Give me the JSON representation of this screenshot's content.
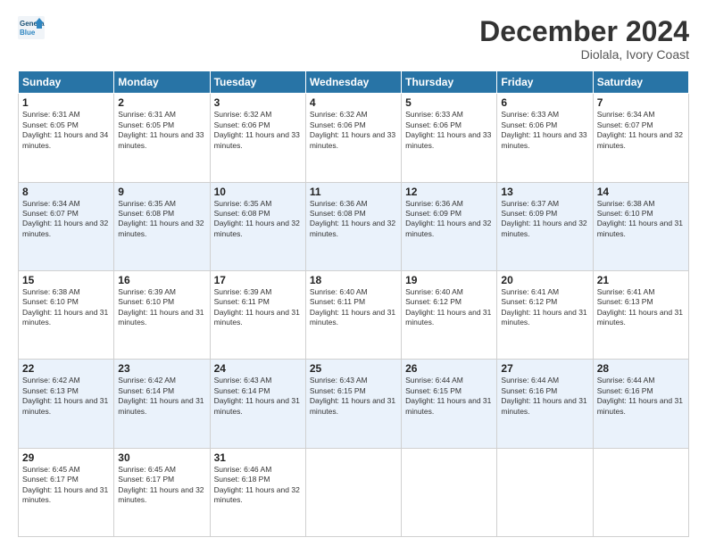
{
  "logo": {
    "line1": "General",
    "line2": "Blue"
  },
  "header": {
    "month": "December 2024",
    "location": "Diolala, Ivory Coast"
  },
  "weekdays": [
    "Sunday",
    "Monday",
    "Tuesday",
    "Wednesday",
    "Thursday",
    "Friday",
    "Saturday"
  ],
  "weeks": [
    [
      {
        "day": "1",
        "sunrise": "6:31 AM",
        "sunset": "6:05 PM",
        "daylight": "11 hours and 34 minutes."
      },
      {
        "day": "2",
        "sunrise": "6:31 AM",
        "sunset": "6:05 PM",
        "daylight": "11 hours and 33 minutes."
      },
      {
        "day": "3",
        "sunrise": "6:32 AM",
        "sunset": "6:06 PM",
        "daylight": "11 hours and 33 minutes."
      },
      {
        "day": "4",
        "sunrise": "6:32 AM",
        "sunset": "6:06 PM",
        "daylight": "11 hours and 33 minutes."
      },
      {
        "day": "5",
        "sunrise": "6:33 AM",
        "sunset": "6:06 PM",
        "daylight": "11 hours and 33 minutes."
      },
      {
        "day": "6",
        "sunrise": "6:33 AM",
        "sunset": "6:06 PM",
        "daylight": "11 hours and 33 minutes."
      },
      {
        "day": "7",
        "sunrise": "6:34 AM",
        "sunset": "6:07 PM",
        "daylight": "11 hours and 32 minutes."
      }
    ],
    [
      {
        "day": "8",
        "sunrise": "6:34 AM",
        "sunset": "6:07 PM",
        "daylight": "11 hours and 32 minutes."
      },
      {
        "day": "9",
        "sunrise": "6:35 AM",
        "sunset": "6:08 PM",
        "daylight": "11 hours and 32 minutes."
      },
      {
        "day": "10",
        "sunrise": "6:35 AM",
        "sunset": "6:08 PM",
        "daylight": "11 hours and 32 minutes."
      },
      {
        "day": "11",
        "sunrise": "6:36 AM",
        "sunset": "6:08 PM",
        "daylight": "11 hours and 32 minutes."
      },
      {
        "day": "12",
        "sunrise": "6:36 AM",
        "sunset": "6:09 PM",
        "daylight": "11 hours and 32 minutes."
      },
      {
        "day": "13",
        "sunrise": "6:37 AM",
        "sunset": "6:09 PM",
        "daylight": "11 hours and 32 minutes."
      },
      {
        "day": "14",
        "sunrise": "6:38 AM",
        "sunset": "6:10 PM",
        "daylight": "11 hours and 31 minutes."
      }
    ],
    [
      {
        "day": "15",
        "sunrise": "6:38 AM",
        "sunset": "6:10 PM",
        "daylight": "11 hours and 31 minutes."
      },
      {
        "day": "16",
        "sunrise": "6:39 AM",
        "sunset": "6:10 PM",
        "daylight": "11 hours and 31 minutes."
      },
      {
        "day": "17",
        "sunrise": "6:39 AM",
        "sunset": "6:11 PM",
        "daylight": "11 hours and 31 minutes."
      },
      {
        "day": "18",
        "sunrise": "6:40 AM",
        "sunset": "6:11 PM",
        "daylight": "11 hours and 31 minutes."
      },
      {
        "day": "19",
        "sunrise": "6:40 AM",
        "sunset": "6:12 PM",
        "daylight": "11 hours and 31 minutes."
      },
      {
        "day": "20",
        "sunrise": "6:41 AM",
        "sunset": "6:12 PM",
        "daylight": "11 hours and 31 minutes."
      },
      {
        "day": "21",
        "sunrise": "6:41 AM",
        "sunset": "6:13 PM",
        "daylight": "11 hours and 31 minutes."
      }
    ],
    [
      {
        "day": "22",
        "sunrise": "6:42 AM",
        "sunset": "6:13 PM",
        "daylight": "11 hours and 31 minutes."
      },
      {
        "day": "23",
        "sunrise": "6:42 AM",
        "sunset": "6:14 PM",
        "daylight": "11 hours and 31 minutes."
      },
      {
        "day": "24",
        "sunrise": "6:43 AM",
        "sunset": "6:14 PM",
        "daylight": "11 hours and 31 minutes."
      },
      {
        "day": "25",
        "sunrise": "6:43 AM",
        "sunset": "6:15 PM",
        "daylight": "11 hours and 31 minutes."
      },
      {
        "day": "26",
        "sunrise": "6:44 AM",
        "sunset": "6:15 PM",
        "daylight": "11 hours and 31 minutes."
      },
      {
        "day": "27",
        "sunrise": "6:44 AM",
        "sunset": "6:16 PM",
        "daylight": "11 hours and 31 minutes."
      },
      {
        "day": "28",
        "sunrise": "6:44 AM",
        "sunset": "6:16 PM",
        "daylight": "11 hours and 31 minutes."
      }
    ],
    [
      {
        "day": "29",
        "sunrise": "6:45 AM",
        "sunset": "6:17 PM",
        "daylight": "11 hours and 31 minutes."
      },
      {
        "day": "30",
        "sunrise": "6:45 AM",
        "sunset": "6:17 PM",
        "daylight": "11 hours and 32 minutes."
      },
      {
        "day": "31",
        "sunrise": "6:46 AM",
        "sunset": "6:18 PM",
        "daylight": "11 hours and 32 minutes."
      },
      null,
      null,
      null,
      null
    ]
  ]
}
